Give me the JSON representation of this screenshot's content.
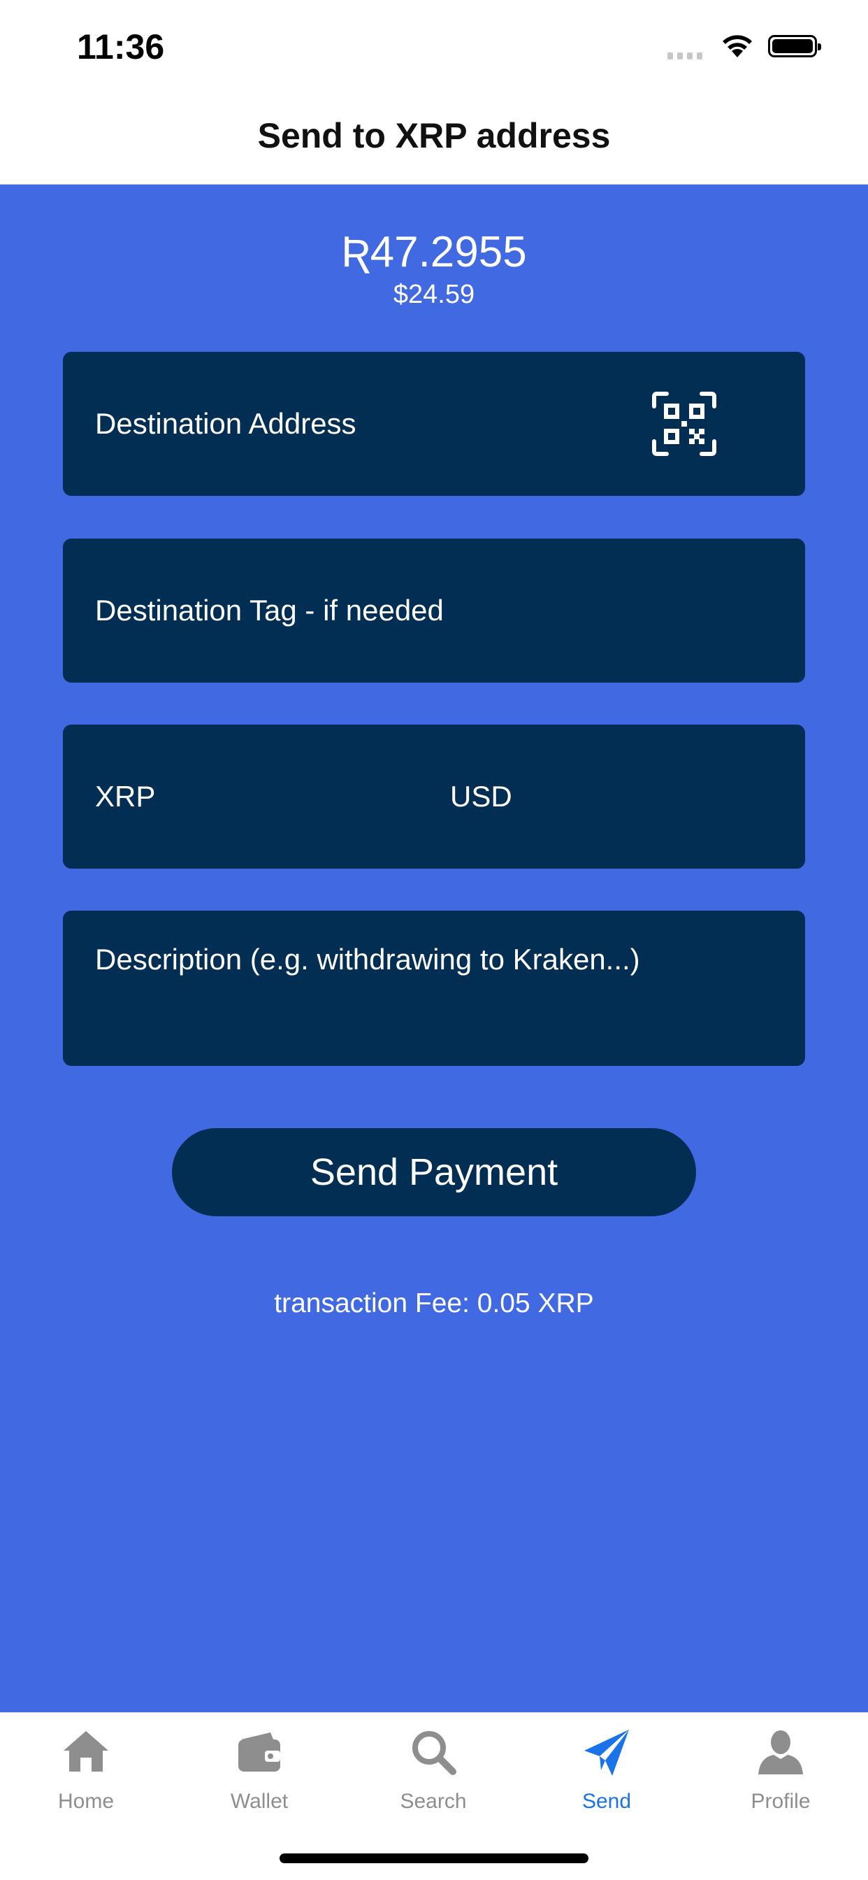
{
  "status": {
    "time": "11:36"
  },
  "header": {
    "title": "Send to XRP address"
  },
  "balance": {
    "xrp": "Ʀ47.2955",
    "usd": "$24.59"
  },
  "form": {
    "destination_address_placeholder": "Destination Address",
    "destination_tag_placeholder": "Destination Tag - if needed",
    "xrp_placeholder": "XRP",
    "usd_placeholder": "USD",
    "description_placeholder": "Description (e.g. withdrawing to Kraken...)",
    "submit_label": "Send Payment",
    "fee_text": "transaction Fee: 0.05 XRP"
  },
  "tabs": [
    {
      "label": "Home",
      "icon": "home-icon",
      "active": false
    },
    {
      "label": "Wallet",
      "icon": "wallet-icon",
      "active": false
    },
    {
      "label": "Search",
      "icon": "search-icon",
      "active": false
    },
    {
      "label": "Send",
      "icon": "send-icon",
      "active": true
    },
    {
      "label": "Profile",
      "icon": "profile-icon",
      "active": false
    }
  ],
  "colors": {
    "background": "#4169e1",
    "field": "#032e54",
    "active_tab": "#1a73e8",
    "inactive_tab": "#8e8e8e"
  }
}
